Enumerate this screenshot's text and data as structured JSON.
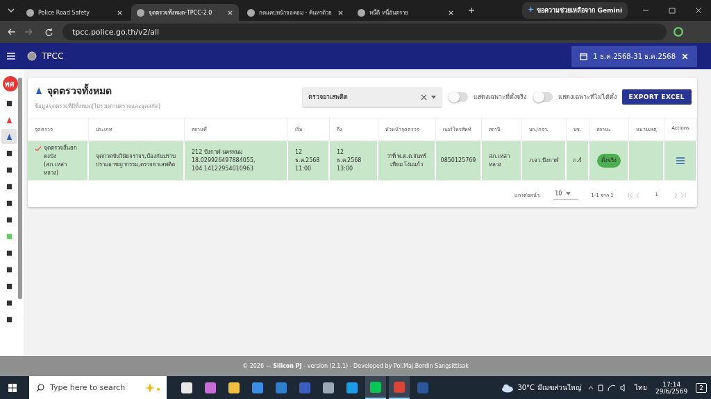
{
  "browser": {
    "tabs": [
      {
        "title": "Police Road Safety",
        "selected": false
      },
      {
        "title": "จุดตรวจทั้งหมด-TPCC-2.0",
        "selected": true
      },
      {
        "title": "กดแคปหน้าจอคอม - ค้นหาด้วย",
        "selected": false
      },
      {
        "title": "หนี้ดี หนี้อันตราย",
        "selected": false
      }
    ],
    "gemini": "ขอความช่วยเหลือจาก Gemini",
    "url": "tpcc.police.go.th/v2/all"
  },
  "header": {
    "logo": "TPCC",
    "date_range": "1 ธ.ค.2568-31 ธ.ค.2568"
  },
  "sidebar": {
    "avatar": "พศ",
    "items": [
      {
        "selected": false
      },
      {
        "selected": false
      },
      {
        "selected": true
      },
      {
        "selected": false
      },
      {
        "selected": false
      },
      {
        "selected": false
      },
      {
        "selected": false
      },
      {
        "selected": false
      },
      {
        "selected": false
      },
      {
        "selected": false
      },
      {
        "selected": false
      },
      {
        "selected": false
      },
      {
        "selected": false
      },
      {
        "selected": false
      }
    ]
  },
  "page": {
    "title": "จุดตรวจทั้งหมด",
    "subtitle": "ข้อมูลจุดตรวจที่มีทั้งหมด(ไม่รวมด่านตรวจและจุดสกัด)",
    "filter": "ตรวจยาเสพติด",
    "toggles": [
      {
        "label": "แสดงเฉพาะที่ตั้งจริง",
        "on": false
      },
      {
        "label": "แสดงเฉพาะที่ไม่ได้ตั้ง",
        "on": false
      }
    ],
    "export_button": "EXPORT EXCEL"
  },
  "table": {
    "columns": [
      "จุดตรวจ",
      "ประเภท",
      "สถานที่",
      "เริ่ม",
      "ถึง",
      "หัวหน้าจุดตรวจ",
      "เบอร์โทรศัพท์",
      "สถานี",
      "บก./ภจว.",
      "บช.",
      "สถานะ",
      "หมายเหตุ",
      "Actions"
    ],
    "rows": [
      {
        "selected": true,
        "checkpoint": "จุดตรวจสี่แยกดงบัง (สภ.เหล่าหลวง)",
        "type": "จุดกวดขันวินัยจราจร,ป้องกันปราบปรามอาชญากรรม,ตรวจยาเสพติด",
        "place": "212 บึงกาฬ-นครพนม 18.029926497884055, 104.14122954010963",
        "start": "12 ธ.ค.2568 11:00",
        "end": "12 ธ.ค.2568 13:00",
        "head": "ว่าที่ พ.ต.ต.จันทร์เทียม โง่มแก้ว",
        "phone": "0850125769",
        "station": "สภ.เหล่าหลวง",
        "division": "ภ.จว.บึงกาฬ",
        "bureau": "ภ.4",
        "status": "ตั้งจริง"
      }
    ]
  },
  "pagination": {
    "label": "แถวต่อหน้า:",
    "per_page": "10",
    "range": "1-1 จาก 1",
    "page": "1"
  },
  "footer": "© 2026 — **Silicon PJ** - version (2.1.1) - Developed by Pol.Maj.Bordin Sangsittisak",
  "taskbar": {
    "search": "Type here to search",
    "apps": [
      {
        "open": false
      },
      {
        "open": false
      },
      {
        "open": false
      },
      {
        "open": false
      },
      {
        "open": false
      },
      {
        "open": false
      },
      {
        "open": false
      },
      {
        "open": false
      },
      {
        "open": true
      },
      {
        "open": true
      },
      {
        "open": false
      }
    ],
    "temperature": "30°C",
    "weather": "มีเมฆส่วนใหญ่",
    "language": "ไทย",
    "time": "17:14",
    "date": "29/6/2569",
    "notifications": "2"
  }
}
